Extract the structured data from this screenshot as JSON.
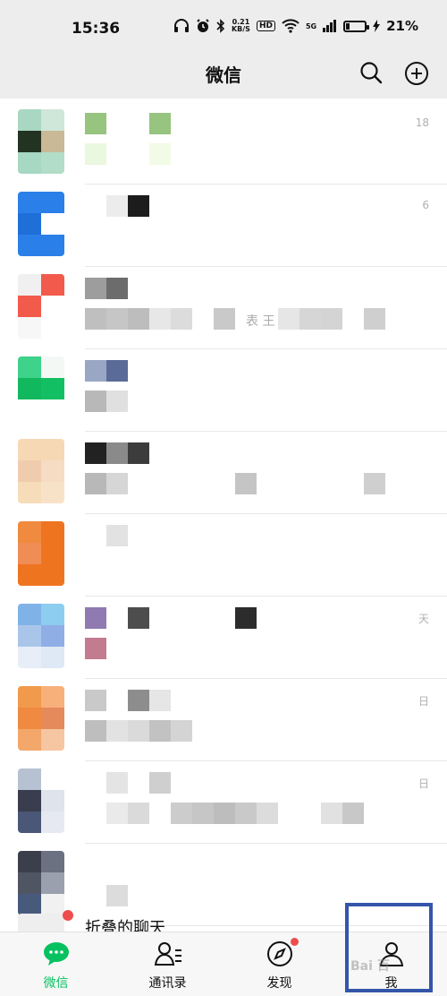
{
  "status_bar": {
    "time": "15:36",
    "net_speed_value": "0.21",
    "net_speed_unit": "KB/S",
    "hd_badge": "HD",
    "signal_label": "5G",
    "battery": "21%",
    "battery_level": 0.21
  },
  "header": {
    "title": "微信"
  },
  "chats": [
    {
      "time": "18",
      "avatar": [
        "#a9d7c3",
        "#cfe7d8",
        "#223322",
        "#c9b996",
        "#a6d8c3",
        "#b2ddc8"
      ],
      "name_pix": [
        "#97c47f",
        "#ffffff",
        "#ffffff",
        "#97c47f"
      ],
      "msg_pix": [
        "#e9f8df",
        "#ffffff",
        "#ffffff",
        "#f2fbe6"
      ]
    },
    {
      "time": "6",
      "avatar": [
        "#2b7fe8",
        "#2b7fe8",
        "#1f6fd8",
        "#ffffff",
        "#2b7fe8",
        "#2b7fe8"
      ],
      "name_pix": [
        "#ffffff",
        "#ececec",
        "#1c1c1c"
      ],
      "msg_pix": []
    },
    {
      "time": "",
      "avatar": [
        "#f0f0f0",
        "#f25a4b",
        "#f25a4b",
        "#ffffff",
        "#f7f7f7",
        "#ffffff"
      ],
      "name_pix": [
        "#9d9d9d",
        "#6c6c6c"
      ],
      "msg_pix": [
        "#bfbfbf",
        "#c6c6c6",
        "#bdbdbd",
        "#e7e7e7",
        "#dcdcdc",
        "#ffffff",
        "#c9c9c9",
        "#ffffff",
        "#ffffff",
        "#e6e6e6",
        "#d6d6d6",
        "#d4d4d4",
        "#ffffff",
        "#cfcfcf"
      ],
      "msg_text": "表 王"
    },
    {
      "time": "",
      "avatar": [
        "#3ed28a",
        "#f4f8f5",
        "#12b85e",
        "#12c063",
        "#ffffff",
        "#ffffff"
      ],
      "name_pix": [
        "#9aa7c4",
        "#5b6b99"
      ],
      "msg_pix": [
        "#b8b8b8",
        "#e0e0e0"
      ]
    },
    {
      "time": "",
      "avatar": [
        "#f6d9b4",
        "#f6d9b4",
        "#f0ccae",
        "#f5dcc2",
        "#f6dcb8",
        "#f8e2c7"
      ],
      "name_pix": [
        "#222222",
        "#8a8a8a",
        "#3c3c3c"
      ],
      "msg_pix": [
        "#b8b8b8",
        "#d6d6d6",
        "#ffffff",
        "#ffffff",
        "#ffffff",
        "#ffffff",
        "#ffffff",
        "#c5c5c5",
        "#ffffff",
        "#ffffff",
        "#ffffff",
        "#ffffff",
        "#ffffff",
        "#cfcfcf"
      ]
    },
    {
      "time": "",
      "avatar": [
        "#f08a3e",
        "#ef7420",
        "#f08d55",
        "#ef7420",
        "#ef7420",
        "#ef7420"
      ],
      "name_pix": [
        "#ffffff",
        "#e2e2e2"
      ],
      "msg_pix": []
    },
    {
      "time": "天",
      "avatar": [
        "#7fb3e8",
        "#8dcdf0",
        "#a9c6ea",
        "#8faee6",
        "#e8eef8",
        "#dfe8f5"
      ],
      "name_pix": [
        "#8f7ab1",
        "#ffffff",
        "#4d4d4d",
        "#ffffff",
        "#ffffff",
        "#ffffff",
        "#ffffff",
        "#2c2c2c"
      ],
      "msg_pix": [
        "#c37b8f"
      ]
    },
    {
      "time": "日",
      "avatar": [
        "#f19a4c",
        "#f8b07b",
        "#f08a40",
        "#e58a5a",
        "#f3a76b",
        "#f6c5a1"
      ],
      "name_pix": [
        "#c9c9c9",
        "#ffffff",
        "#8d8d8d",
        "#e6e6e6"
      ],
      "msg_pix": [
        "#bebebe",
        "#e2e2e2",
        "#dadada",
        "#c2c2c2",
        "#d4d4d4"
      ]
    },
    {
      "time": "日",
      "avatar": [
        "#b6c1d1",
        "#ffffff",
        "#3a3d4d",
        "#dfe3ec",
        "#4a5776",
        "#e6e9f1"
      ],
      "name_pix": [
        "#ffffff",
        "#e4e4e4",
        "#ffffff",
        "#cfcfcf"
      ],
      "msg_pix": [
        "#ffffff",
        "#eaeaea",
        "#dadada",
        "#ffffff",
        "#cccccc",
        "#c6c6c6",
        "#bdbdbd",
        "#c9c9c9",
        "#dcdcdc",
        "#ffffff",
        "#ffffff",
        "#e1e1e1",
        "#c8c8c8"
      ]
    },
    {
      "time": "",
      "avatar": [
        "#3b3f4c",
        "#6c7182",
        "#505563",
        "#9aa0ae",
        "#485a7c",
        "#f1f1f1"
      ],
      "name_pix": [],
      "msg_pix": [
        "#ffffff",
        "#dcdcdc"
      ]
    }
  ],
  "folded": {
    "label": "折叠的聊天"
  },
  "tabs": [
    {
      "label": "微信"
    },
    {
      "label": "通讯录"
    },
    {
      "label": "发现"
    },
    {
      "label": "我"
    }
  ],
  "watermark": "Bai 百",
  "colors": {
    "accent": "#07c160",
    "badge": "#ee4d4d",
    "highlight": "#3355aa",
    "bar_bg": "#ededed"
  }
}
